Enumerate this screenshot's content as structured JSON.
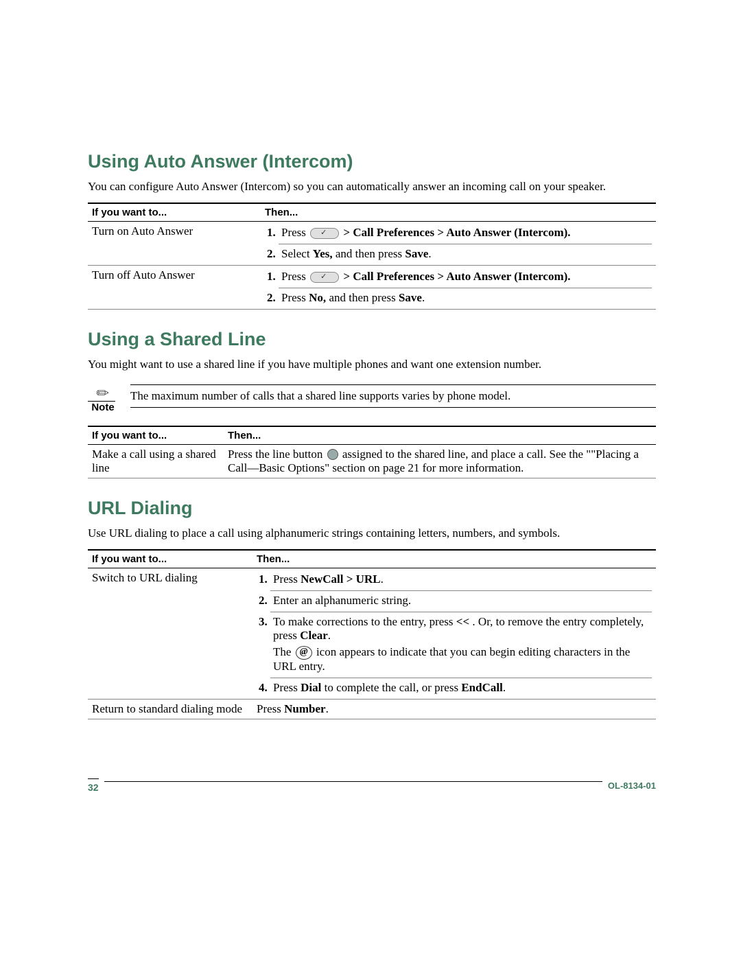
{
  "section1": {
    "heading": "Using Auto Answer (Intercom)",
    "intro": "You can configure Auto Answer (Intercom) so you can automatically answer an incoming call on your speaker.",
    "table": {
      "h1": "If you want to...",
      "h2": "Then...",
      "rows": [
        {
          "want": "Turn on Auto Answer",
          "step1_pre": "Press ",
          "step1_post": " > Call Preferences > Auto Answer (Intercom).",
          "step2_a": "Select ",
          "step2_b": "Yes,",
          "step2_c": " and then press ",
          "step2_d": "Save",
          "step2_e": "."
        },
        {
          "want": "Turn off Auto Answer",
          "step1_pre": "Press ",
          "step1_post": " > Call Preferences > Auto Answer (Intercom).",
          "step2_a": "Press ",
          "step2_b": "No,",
          "step2_c": " and then press ",
          "step2_d": "Save",
          "step2_e": "."
        }
      ]
    }
  },
  "section2": {
    "heading": "Using a Shared Line",
    "intro": "You might want to use a shared line if you have multiple phones and want one extension number.",
    "note_label": "Note",
    "note_body": "The maximum number of calls that a shared line supports varies by phone model.",
    "table": {
      "h1": "If you want to...",
      "h2": "Then...",
      "row": {
        "want": "Make a call using a shared line",
        "then_a": "Press the line button ",
        "then_b": " assigned to the shared line, and place a call. See the \"\"Placing a Call—Basic Options\" section on page 21 for more information."
      }
    }
  },
  "section3": {
    "heading": "URL Dialing",
    "intro": "Use URL dialing to place a call using alphanumeric strings containing letters, numbers, and symbols.",
    "table": {
      "h1": "If you want to...",
      "h2": "Then...",
      "row1": {
        "want": "Switch to URL dialing",
        "s1_a": "Press ",
        "s1_b": "NewCall > URL",
        "s1_c": ".",
        "s2": "Enter an alphanumeric string.",
        "s3_a": "To make corrections to the entry, press ",
        "s3_b": "<<",
        "s3_c": " . Or, to remove the entry completely, press ",
        "s3_d": "Clear",
        "s3_e": ".",
        "s3_note_a": "The ",
        "s3_note_b": " icon appears to indicate that you can begin editing characters in the URL entry.",
        "s4_a": "Press ",
        "s4_b": "Dial",
        "s4_c": " to complete the call, or press ",
        "s4_d": "EndCall",
        "s4_e": "."
      },
      "row2": {
        "want": "Return to standard dialing mode",
        "then_a": "Press ",
        "then_b": "Number",
        "then_c": "."
      }
    }
  },
  "footer": {
    "pagenum": "32",
    "docid": "OL-8134-01"
  }
}
